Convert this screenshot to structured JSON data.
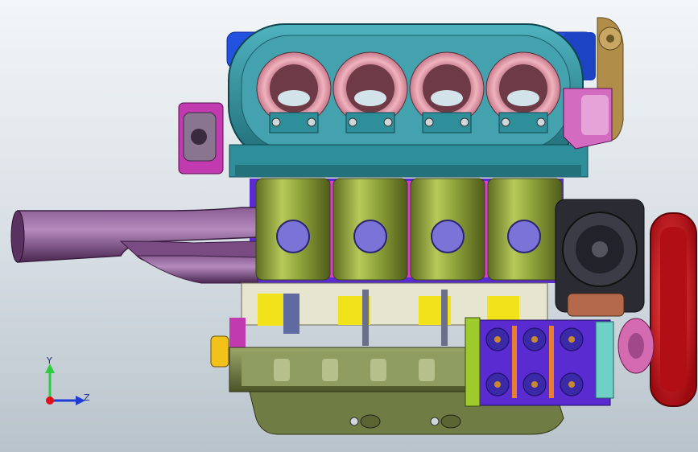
{
  "viewport": {
    "background_top": "#f3f6f8",
    "background_bottom": "#b9c3cb"
  },
  "triad": {
    "y_label": "Y",
    "z_label": "Z",
    "y_axis_color": "#2ecc40",
    "z_axis_color": "#1f3bd6",
    "x_axis_color": "#e0101a"
  },
  "model": {
    "icon": "engine-assembly-model",
    "colors": {
      "airbox": "#2e8f9b",
      "trumpet": "#d98a98",
      "cylinders": "#8ea33a",
      "exhaust": "#6e3f73",
      "pulley": "#d0121c",
      "alternator": "#2b2b33",
      "head": "#2352e0",
      "oil_pan": "#6f7d44",
      "injector_pink": "#e03bd6",
      "purple_block": "#5a2bd1",
      "tan_bracket": "#b08e4a",
      "yellow_parts": "#f2e21a"
    }
  }
}
